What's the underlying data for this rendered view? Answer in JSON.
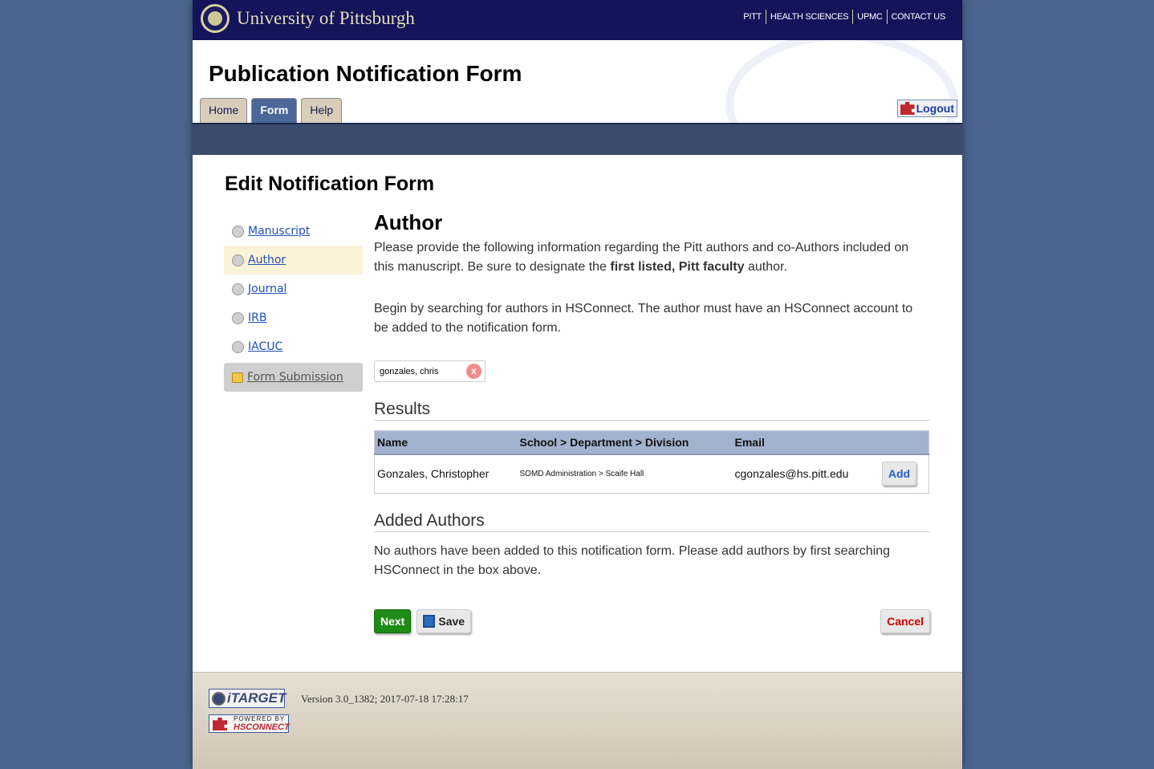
{
  "header": {
    "university": "University of Pittsburgh",
    "links": [
      "PITT",
      "HEALTH SCIENCES",
      "UPMC",
      "CONTACT US"
    ]
  },
  "app_title": "Publication Notification Form",
  "tabs": [
    {
      "label": "Home"
    },
    {
      "label": "Form",
      "active": true
    },
    {
      "label": "Help"
    }
  ],
  "logout_label": "Logout",
  "page_heading": "Edit Notification Form",
  "sidebar": {
    "items": [
      {
        "label": "Manuscript"
      },
      {
        "label": "Author",
        "selected": true
      },
      {
        "label": "Journal"
      },
      {
        "label": "IRB"
      },
      {
        "label": "IACUC"
      },
      {
        "label": "Form Submission",
        "icon": "lock-icon"
      }
    ]
  },
  "section": {
    "title": "Author",
    "intro_1": "Please provide the following information regarding the Pitt authors and co-Authors included on this manuscript. Be sure to designate the ",
    "intro_bold": "first listed, Pitt faculty",
    "intro_2": " author.",
    "search_help": "Begin by searching for authors in HSConnect. The author must have an HSConnect account to be added to the notification form."
  },
  "search": {
    "value": "gonzales, chris",
    "clear_label": "x"
  },
  "results": {
    "title": "Results",
    "columns": [
      "Name",
      "School > Department > Division",
      "Email",
      ""
    ],
    "rows": [
      {
        "name": "Gonzales, Christopher",
        "dept": "SOMD Administration > Scaife Hall",
        "email": "cgonzales@hs.pitt.edu",
        "action": "Add"
      }
    ]
  },
  "added": {
    "title": "Added Authors",
    "message": "No authors have been added to this notification form. Please add authors by first searching HSConnect in the box above."
  },
  "buttons": {
    "next": "Next",
    "save": "Save",
    "cancel": "Cancel"
  },
  "footer": {
    "itarget": "iTARGET",
    "powered_by": "POWERED BY",
    "hsconnect": "HSCONNECT",
    "version": "Version 3.0_1382; 2017-07-18 17:28:17"
  }
}
